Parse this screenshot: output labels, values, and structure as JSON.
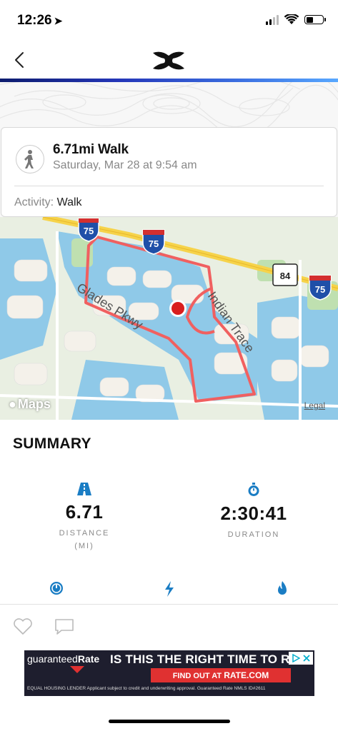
{
  "status_bar": {
    "time": "12:26"
  },
  "nav": {
    "logo": "under-armour-logo"
  },
  "activity": {
    "title": "6.71mi Walk",
    "date": "Saturday, Mar 28 at 9:54 am",
    "type_label": "Activity:",
    "type_value": "Walk"
  },
  "map": {
    "roads": [
      "Glades Pkwy",
      "Indian Trace"
    ],
    "shields": [
      "75",
      "75",
      "75",
      "84"
    ],
    "brand": "Maps",
    "legal": "Legal",
    "route_color": "#f06060"
  },
  "summary": {
    "title": "SUMMARY",
    "distance": {
      "value": "6.71",
      "label": "DISTANCE",
      "unit": "(MI)"
    },
    "duration": {
      "value": "2:30:41",
      "label": "DURATION"
    }
  },
  "ad": {
    "brand_left": "guaranteed",
    "brand_right": "Rate",
    "headline": "IS THIS THE RIGHT TIME TO R",
    "cta_prefix": "FIND OUT AT ",
    "cta_site": "RATE.COM",
    "fine_print": "EQUAL HOUSING LENDER   Applicant subject to credit and underwriting approval. Guaranteed Rate NMLS ID#2611"
  },
  "colors": {
    "accent": "#1a7dc4",
    "nav_gradient_start": "#0d1c6e",
    "nav_gradient_end": "#58a8ff"
  }
}
